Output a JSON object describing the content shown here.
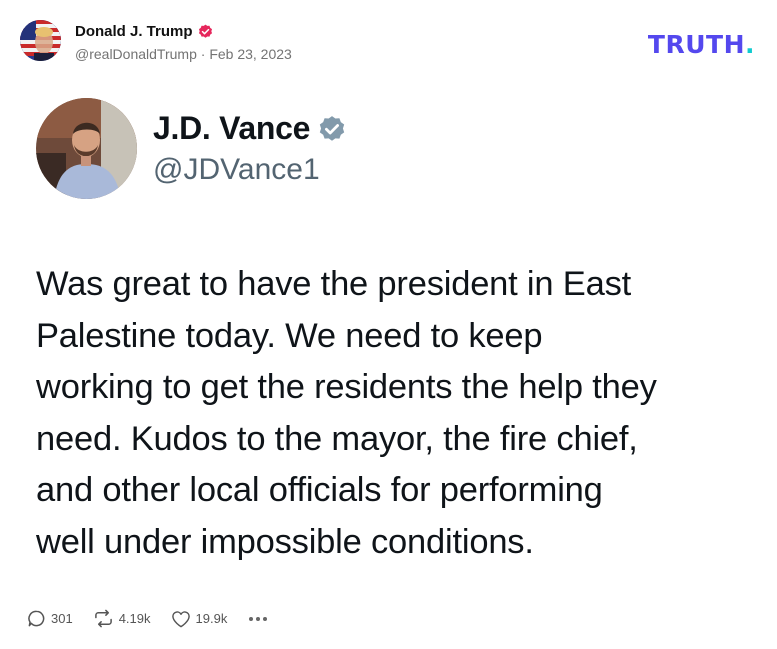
{
  "post": {
    "author_name": "Donald J. Trump",
    "handle": "@realDonaldTrump",
    "separator": "·",
    "date": "Feb 23, 2023"
  },
  "brand": {
    "logo_text": "TRUTH",
    "logo_dot": ".",
    "color": "#5448ee",
    "dot_color": "#10cbd0"
  },
  "embedded_tweet": {
    "name": "J.D. Vance",
    "handle": "@JDVance1",
    "text_lines": [
      "Was great to have the president in East",
      "Palestine today. We need to keep",
      "working to get the residents the help they",
      "need. Kudos to the mayor, the fire chief,",
      "and other local officials for performing",
      "well under impossible conditions."
    ]
  },
  "actions": {
    "replies": "301",
    "retruths": "4.19k",
    "likes": "19.9k",
    "more_icon": "more-horizontal-icon"
  },
  "icons": {
    "verified_poster": "verified-badge-icon",
    "verified_embed": "verified-badge-icon",
    "reply": "reply-icon",
    "retruth": "retruth-icon",
    "like": "heart-icon"
  }
}
